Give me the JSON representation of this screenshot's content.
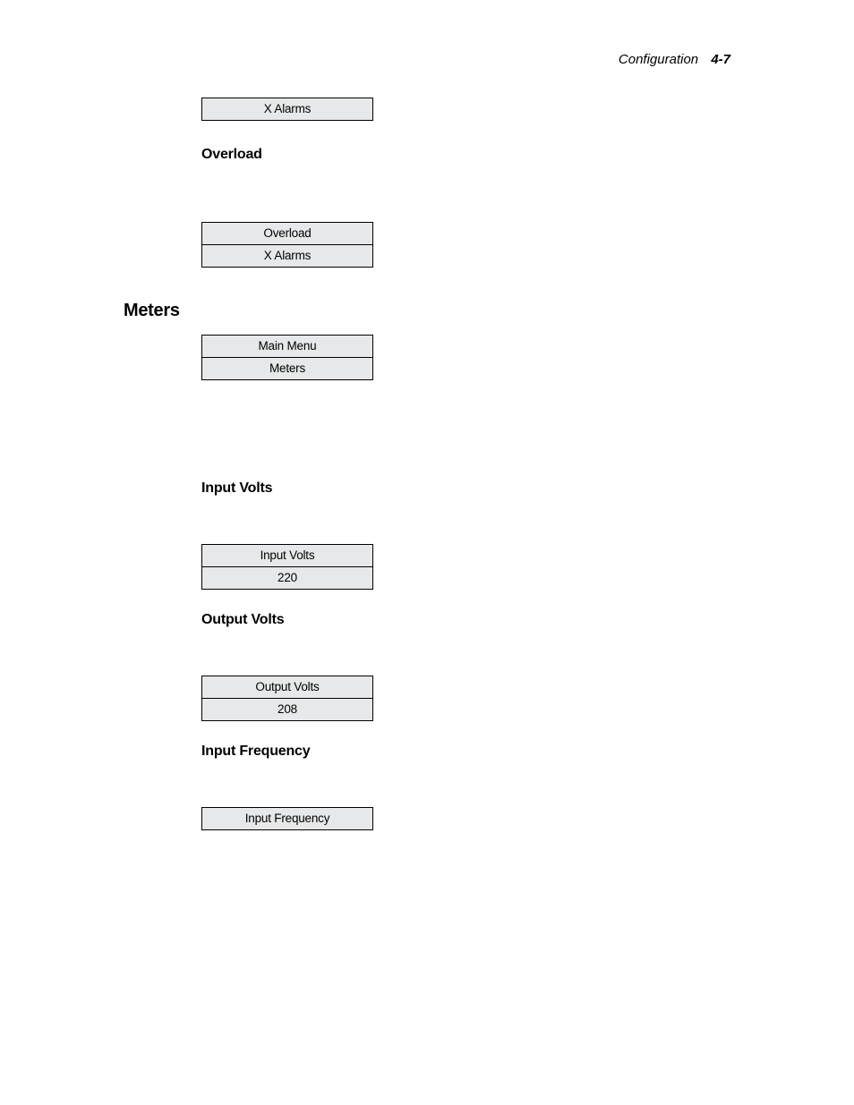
{
  "header": {
    "section": "Configuration",
    "page": "4-7"
  },
  "lcd_xalarms": {
    "rows": [
      "X Alarms"
    ]
  },
  "heading_overload": "Overload",
  "lcd_overload": {
    "rows": [
      "Overload",
      "X Alarms"
    ]
  },
  "heading_meters": "Meters",
  "lcd_meters_main": {
    "rows": [
      "Main Menu",
      "Meters"
    ]
  },
  "heading_input_volts": "Input Volts",
  "lcd_input_volts": {
    "rows": [
      "Input Volts",
      "220"
    ]
  },
  "heading_output_volts": "Output Volts",
  "lcd_output_volts": {
    "rows": [
      "Output Volts",
      "208"
    ]
  },
  "heading_input_freq": "Input Frequency",
  "lcd_input_freq": {
    "rows": [
      "Input Frequency"
    ]
  }
}
